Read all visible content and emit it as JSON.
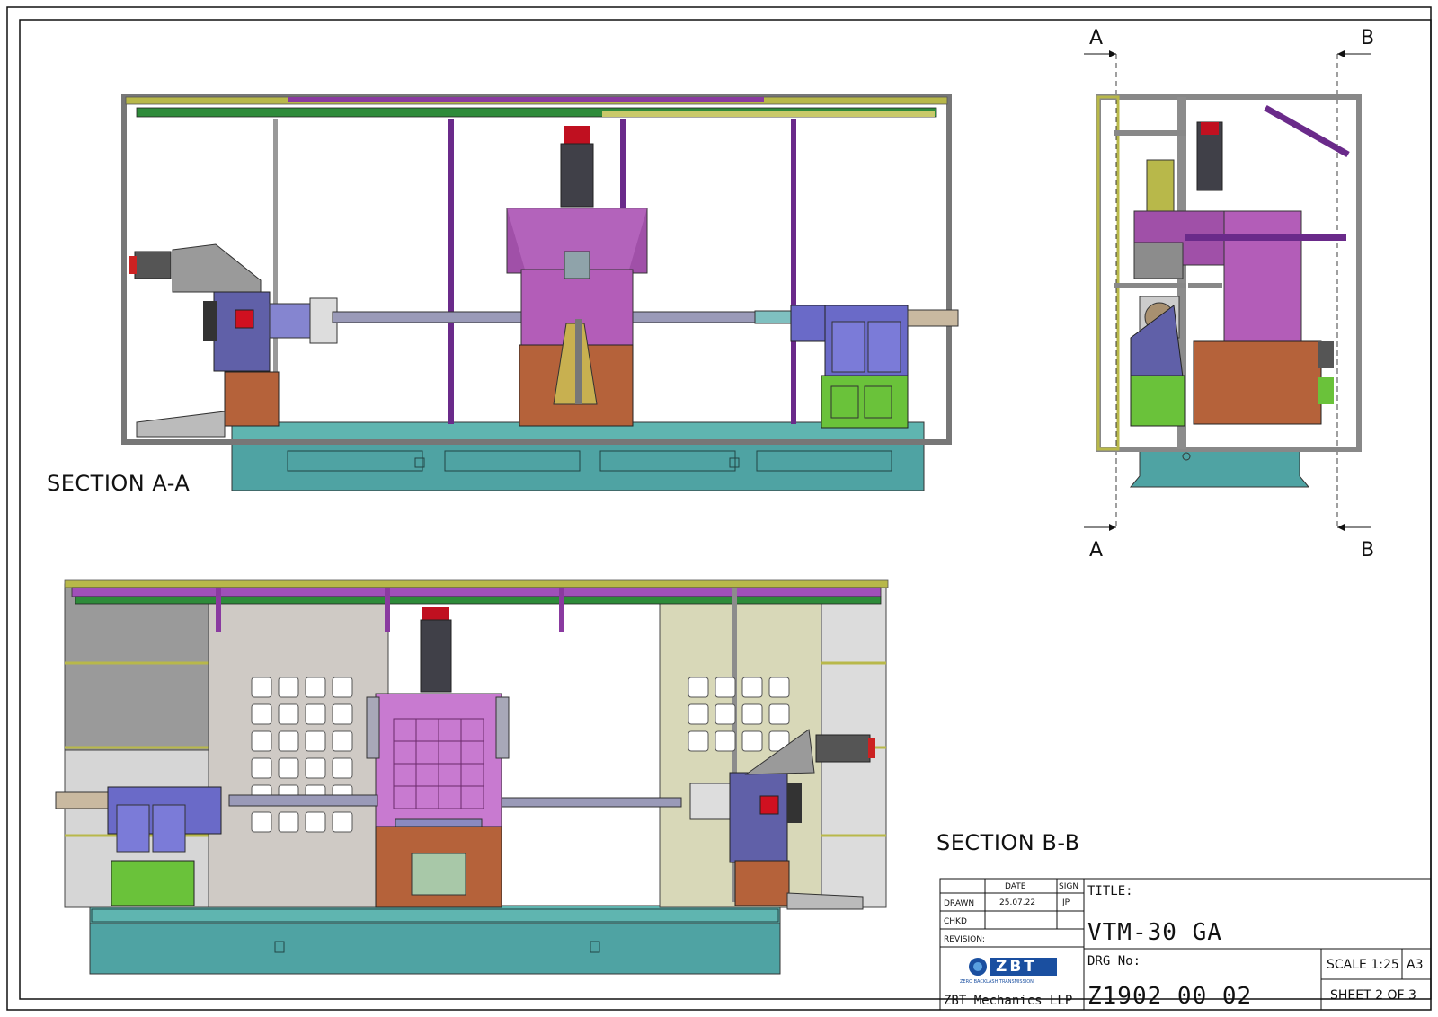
{
  "sections": {
    "a": "SECTION A-A",
    "b": "SECTION B-B"
  },
  "cut_markers": {
    "a_top": "A",
    "b_top": "B",
    "a_bottom": "A",
    "b_bottom": "B"
  },
  "title_block": {
    "date_header": "DATE",
    "sign_header": "SIGN",
    "drawn_label": "DRAWN",
    "drawn_date": "25.07.22",
    "drawn_sign": "JP",
    "checked_label": "CHKD",
    "revision_label": "REVISION:",
    "title_label": "TITLE:",
    "title_value": "VTM-30 GA",
    "drg_label": "DRG No:",
    "drg_value": "Z1902 00 02",
    "company": "ZBT Mechanics LLP",
    "logo_text": "ZBT",
    "logo_tagline": "ZERO BACKLASH TRANSMISSION",
    "scale": "SCALE 1:25",
    "paper": "A3",
    "sheet": "SHEET 2 OF 3"
  },
  "colors": {
    "teal_base": "#4fa3a3",
    "frame_grey": "#8c8c8c",
    "magenta": "#b35db8",
    "purple_rail": "#6a2a8a",
    "blue_housing": "#6a6ac8",
    "green_box": "#6ac23a",
    "brown_box": "#b5623a",
    "olive_rail": "#b8b84a",
    "green_rail": "#2e8b3a"
  }
}
